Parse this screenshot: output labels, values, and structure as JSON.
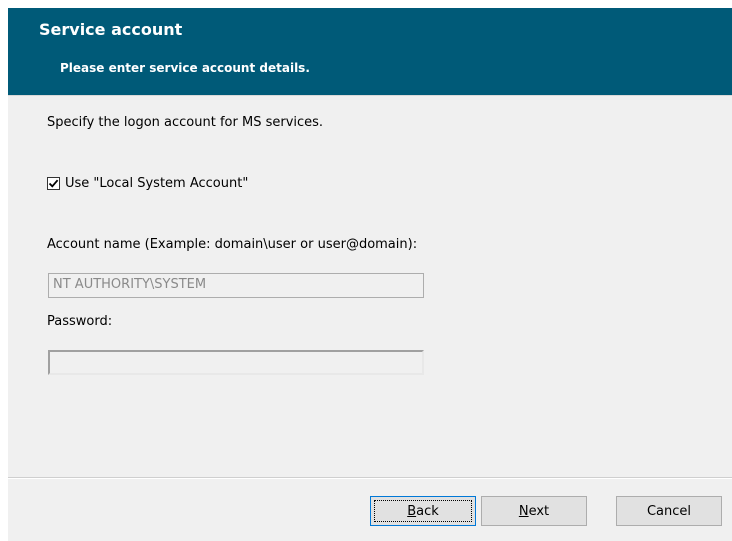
{
  "header": {
    "title": "Service account",
    "subtitle": "Please enter service account details."
  },
  "body": {
    "intro": "Specify the logon account for MS services.",
    "use_local_system_label": "Use \"Local System Account\"",
    "use_local_system_checked": true,
    "account_name_label": "Account name (Example: domain\\user or user@domain):",
    "account_name_value": "NT AUTHORITY\\SYSTEM",
    "password_label": "Password:",
    "password_value": ""
  },
  "buttons": {
    "back": {
      "mnemonic": "B",
      "rest": "ack"
    },
    "next": {
      "mnemonic": "N",
      "rest": "ext"
    },
    "cancel": "Cancel"
  }
}
